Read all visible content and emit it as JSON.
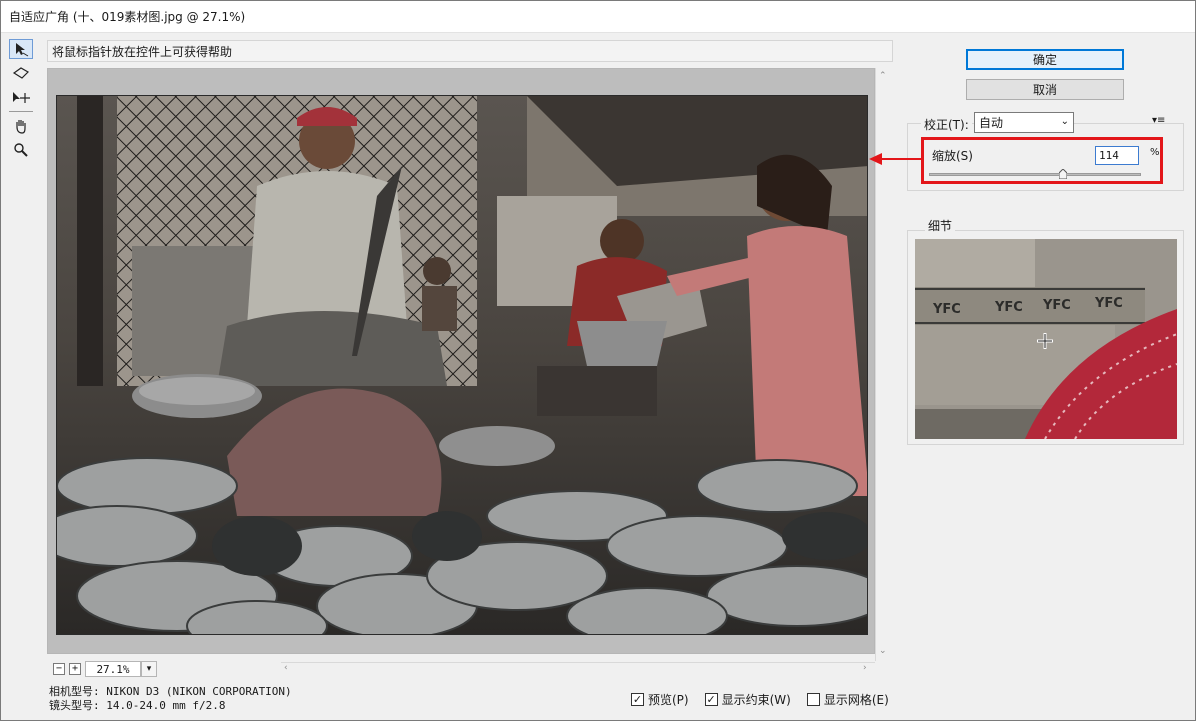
{
  "window": {
    "title": "自适应广角 (十、019素材图.jpg @ 27.1%)"
  },
  "tools": [
    {
      "name": "constraint-tool-icon",
      "active": true
    },
    {
      "name": "polygon-constraint-tool-icon",
      "active": false
    },
    {
      "name": "move-tool-icon",
      "active": false
    },
    {
      "name": "hand-tool-icon",
      "active": false
    },
    {
      "name": "zoom-tool-icon",
      "active": false
    }
  ],
  "hint": {
    "text": "将鼠标指针放在控件上可获得帮助"
  },
  "zoom": {
    "minus": "−",
    "plus": "+",
    "value": "27.1%"
  },
  "camera": {
    "model": "相机型号: NIKON D3 (NIKON CORPORATION)",
    "lens": "镜头型号: 14.0-24.0 mm f/2.8"
  },
  "options": {
    "preview": {
      "label": "预览(P)",
      "checked": true
    },
    "show_constraints": {
      "label": "显示约束(W)",
      "checked": true
    },
    "show_grid": {
      "label": "显示网格(E)",
      "checked": false
    }
  },
  "buttons": {
    "ok": "确定",
    "cancel": "取消"
  },
  "correction": {
    "label": "校正(T):",
    "selected": "自动",
    "scale_label": "缩放(S)",
    "scale_value": "114",
    "scale_unit": "%",
    "scale_fraction": 0.63
  },
  "detail": {
    "label": "细节",
    "texts": [
      "YFC",
      "YFC",
      "YFC",
      "YFC"
    ]
  },
  "watermark": "",
  "colors": {
    "highlight": "#e3161a",
    "accent": "#0078d7"
  }
}
